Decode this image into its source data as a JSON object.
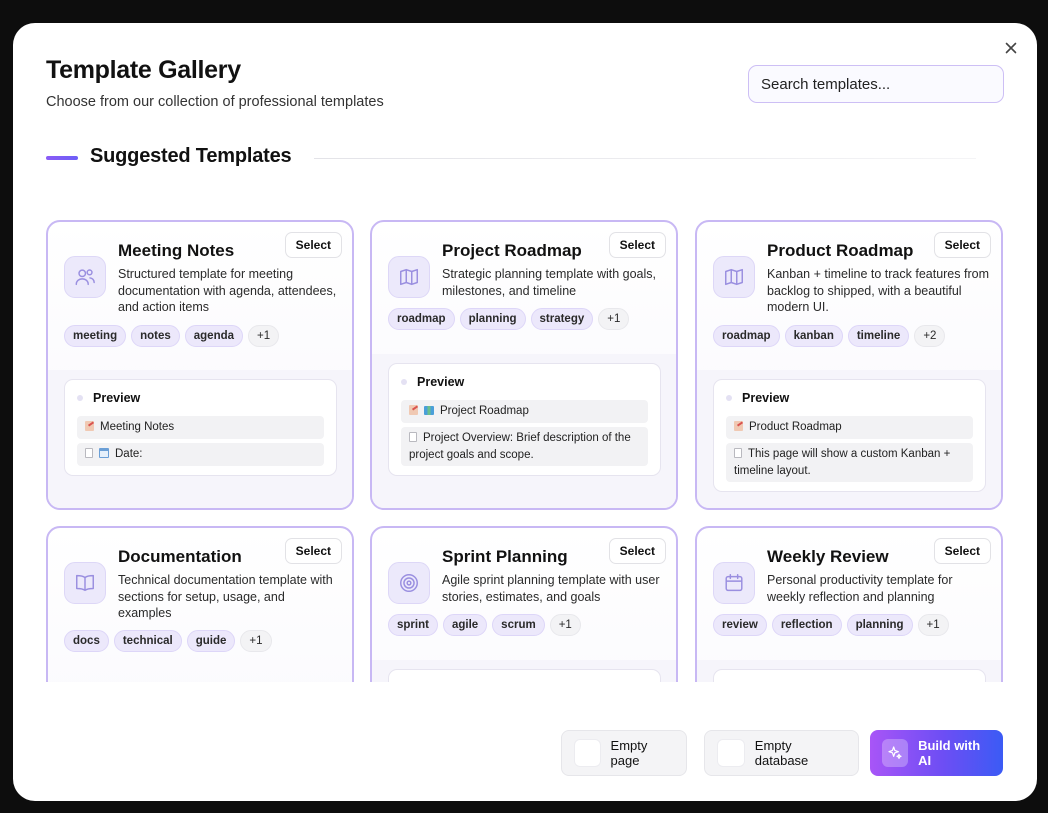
{
  "modal": {
    "title": "Template Gallery",
    "subtitle": "Choose from our collection of professional templates",
    "search_placeholder": "Search templates...",
    "section_title": "Suggested Templates",
    "close_icon": "close-icon"
  },
  "cards": [
    {
      "title": "Meeting Notes",
      "icon": "users-icon",
      "select_label": "Select",
      "description": "Structured template for meeting documentation with agenda, attendees, and action items",
      "tags": [
        "meeting",
        "notes",
        "agenda"
      ],
      "more": "+1",
      "preview_label": "Preview",
      "preview_rows": [
        "Meeting Notes",
        "Date:"
      ]
    },
    {
      "title": "Project Roadmap",
      "icon": "map-icon",
      "select_label": "Select",
      "description": "Strategic planning template with goals, milestones, and timeline",
      "tags": [
        "roadmap",
        "planning",
        "strategy"
      ],
      "more": "+1",
      "preview_label": "Preview",
      "preview_rows": [
        "Project Roadmap",
        "Project Overview: Brief description of the project goals and scope."
      ]
    },
    {
      "title": "Product Roadmap",
      "icon": "map-icon",
      "select_label": "Select",
      "description": "Kanban + timeline to track features from backlog to shipped, with a beautiful modern UI.",
      "tags": [
        "roadmap",
        "kanban",
        "timeline"
      ],
      "more": "+2",
      "preview_label": "Preview",
      "preview_rows": [
        "Product Roadmap",
        "This page will show a custom Kanban + timeline layout."
      ]
    },
    {
      "title": "Documentation",
      "icon": "book-icon",
      "select_label": "Select",
      "description": "Technical documentation template with sections for setup, usage, and examples",
      "tags": [
        "docs",
        "technical",
        "guide"
      ],
      "more": "+1"
    },
    {
      "title": "Sprint Planning",
      "icon": "target-icon",
      "select_label": "Select",
      "description": "Agile sprint planning template with user stories, estimates, and goals",
      "tags": [
        "sprint",
        "agile",
        "scrum"
      ],
      "more": "+1"
    },
    {
      "title": "Weekly Review",
      "icon": "calendar-icon",
      "select_label": "Select",
      "description": "Personal productivity template for weekly reflection and planning",
      "tags": [
        "review",
        "reflection",
        "planning"
      ],
      "more": "+1"
    }
  ],
  "footer": {
    "empty_page": "Empty page",
    "empty_database": "Empty database",
    "build_ai": "Build with AI"
  },
  "colors": {
    "accent": "#8b5cf6",
    "card_border": "#c8b8f4",
    "tag_bg": "#ece8fb",
    "ai_gradient_start": "#a855f7",
    "ai_gradient_end": "#3b5bf5"
  }
}
